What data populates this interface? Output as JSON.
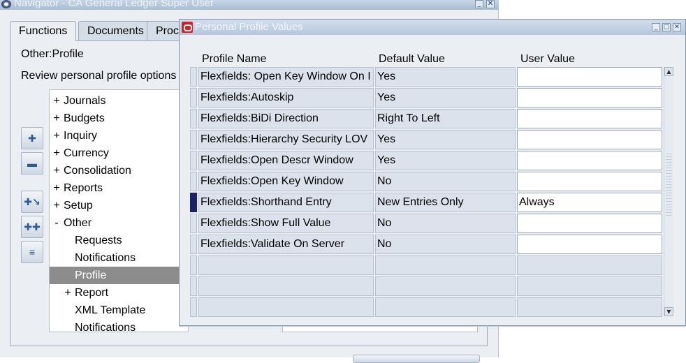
{
  "navigator": {
    "title": "Navigator - CA General Ledger Super User",
    "tabs": [
      "Functions",
      "Documents",
      "Proc"
    ],
    "context": "Other:Profile",
    "instructions": "Review personal profile options",
    "tree": [
      {
        "toggle": "+",
        "label": "Journals",
        "indent": 0
      },
      {
        "toggle": "+",
        "label": "Budgets",
        "indent": 0
      },
      {
        "toggle": "+",
        "label": "Inquiry",
        "indent": 0
      },
      {
        "toggle": "+",
        "label": "Currency",
        "indent": 0
      },
      {
        "toggle": "+",
        "label": "Consolidation",
        "indent": 0
      },
      {
        "toggle": "+",
        "label": "Reports",
        "indent": 0
      },
      {
        "toggle": "+",
        "label": "Setup",
        "indent": 0
      },
      {
        "toggle": "-",
        "label": "Other",
        "indent": 0
      },
      {
        "toggle": "",
        "label": "Requests",
        "indent": 1
      },
      {
        "toggle": "",
        "label": "Notifications",
        "indent": 1
      },
      {
        "toggle": "",
        "label": "Profile",
        "indent": 1,
        "selected": true
      },
      {
        "toggle": "+",
        "label": "Report",
        "indent": 1
      },
      {
        "toggle": "",
        "label": "XML Template",
        "indent": 1
      },
      {
        "toggle": "",
        "label": "Notifications",
        "indent": 1
      }
    ],
    "side_buttons": [
      "expand-one-icon",
      "collapse-one-icon",
      "expand-branch-icon",
      "expand-all-icon",
      "collapse-all-icon"
    ]
  },
  "profile_window": {
    "title": "Personal Profile Values",
    "columns": {
      "name": "Profile Name",
      "default": "Default Value",
      "user": "User Value"
    },
    "rows": [
      {
        "name": "Flexfields: Open Key Window On I",
        "default": "Yes",
        "user": ""
      },
      {
        "name": "Flexfields:Autoskip",
        "default": "Yes",
        "user": ""
      },
      {
        "name": "Flexfields:BiDi Direction",
        "default": "Right To Left",
        "user": ""
      },
      {
        "name": "Flexfields:Hierarchy Security LOV",
        "default": "Yes",
        "user": ""
      },
      {
        "name": "Flexfields:Open Descr Window",
        "default": "Yes",
        "user": ""
      },
      {
        "name": "Flexfields:Open Key Window",
        "default": "No",
        "user": ""
      },
      {
        "name": "Flexfields:Shorthand Entry",
        "default": "New Entries Only",
        "user": "Always",
        "current": true
      },
      {
        "name": "Flexfields:Show Full Value",
        "default": "No",
        "user": ""
      },
      {
        "name": "Flexfields:Validate On Server",
        "default": "No",
        "user": ""
      },
      {
        "name": "",
        "default": "",
        "user": "",
        "empty": true
      },
      {
        "name": "",
        "default": "",
        "user": "",
        "empty": true
      },
      {
        "name": "",
        "default": "",
        "user": "",
        "empty": true
      }
    ]
  },
  "colors": {
    "current_row_marker": "#1a2169",
    "oracle_red": "#d5202a",
    "selected_tree_item": "#8c8c8c"
  }
}
